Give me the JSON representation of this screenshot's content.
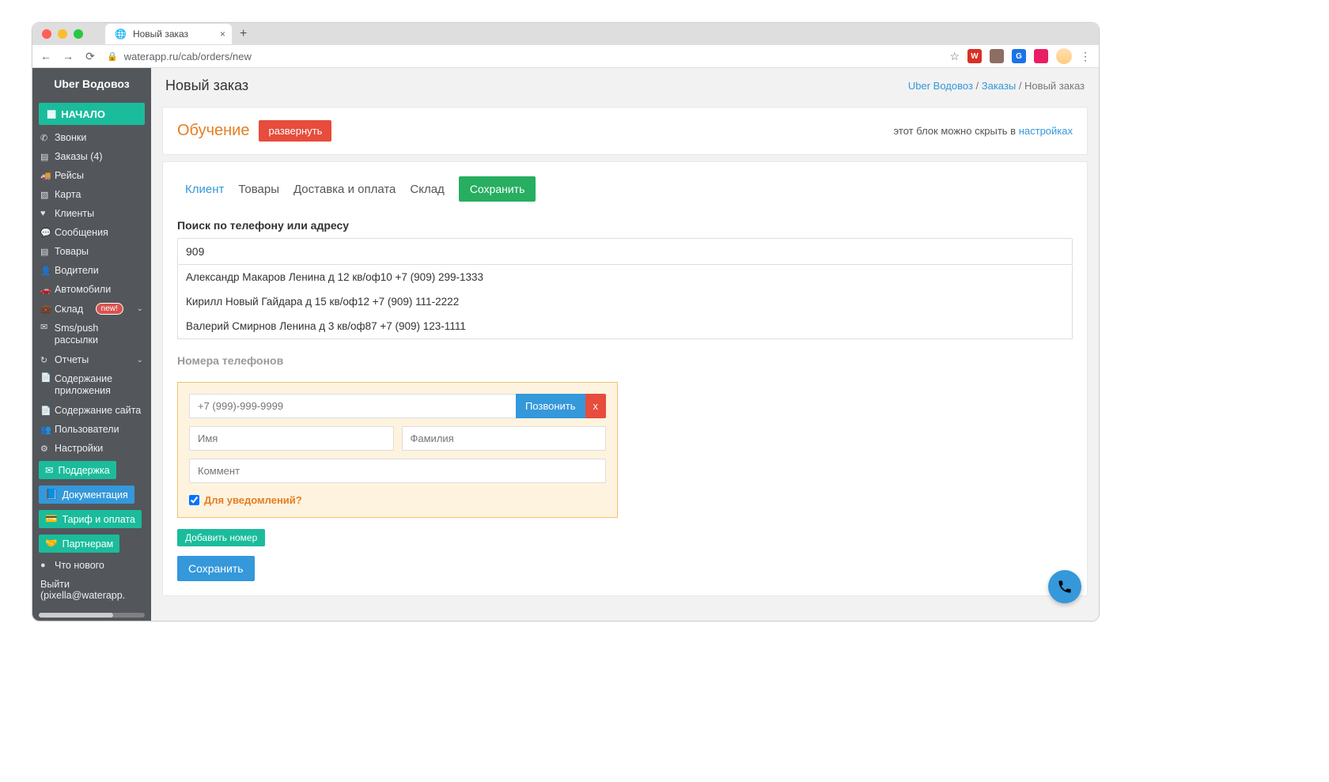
{
  "browser": {
    "tab_title": "Новый заказ",
    "url": "waterapp.ru/cab/orders/new"
  },
  "sidebar": {
    "brand": "Uber Водовоз",
    "start": "НАЧАЛО",
    "items": {
      "calls": "Звонки",
      "orders": "Заказы (4)",
      "trips": "Рейсы",
      "map": "Карта",
      "clients": "Клиенты",
      "messages": "Сообщения",
      "products": "Товары",
      "drivers": "Водители",
      "vehicles": "Автомобили",
      "warehouse": "Склад",
      "warehouse_badge": "new!",
      "smspush": "Sms/push рассылки",
      "reports": "Отчеты",
      "app_content": "Содержание приложения",
      "site_content": "Содержание сайта",
      "users": "Пользователи",
      "settings": "Настройки",
      "support": "Поддержка",
      "docs": "Документация",
      "tariff": "Тариф и оплата",
      "partners": "Партнерам",
      "whatsnew": "Что нового",
      "logout": "Выйти (pixella@waterapp."
    }
  },
  "header": {
    "title": "Новый заказ",
    "crumb1": "Uber Водовоз",
    "crumb2": "Заказы",
    "crumb3": "Новый заказ"
  },
  "training": {
    "title": "Обучение",
    "expand": "развернуть",
    "hint_prefix": "этот блок можно скрыть в ",
    "hint_link": "настройках"
  },
  "tabs": {
    "client": "Клиент",
    "products": "Товары",
    "delivery": "Доставка и оплата",
    "warehouse": "Склад",
    "save": "Сохранить"
  },
  "search": {
    "label": "Поиск по телефону или адресу",
    "value": "909",
    "results": [
      "Александр Макаров Ленина д 12 кв/оф10 +7 (909) 299-1333",
      "Кирилл Новый Гайдара д 15 кв/оф12 +7 (909) 111-2222",
      "Валерий Смирнов Ленина д 3 кв/оф87 +7 (909) 123-1111"
    ]
  },
  "phones": {
    "section_label": "Номера телефонов",
    "placeholder": "+7 (999)-999-9999",
    "call_btn": "Позвонить",
    "delete_btn": "x",
    "name_ph": "Имя",
    "surname_ph": "Фамилия",
    "comment_ph": "Коммент",
    "notif_label": "Для уведомлений?",
    "add_btn": "Добавить номер",
    "save_btn": "Сохранить"
  }
}
